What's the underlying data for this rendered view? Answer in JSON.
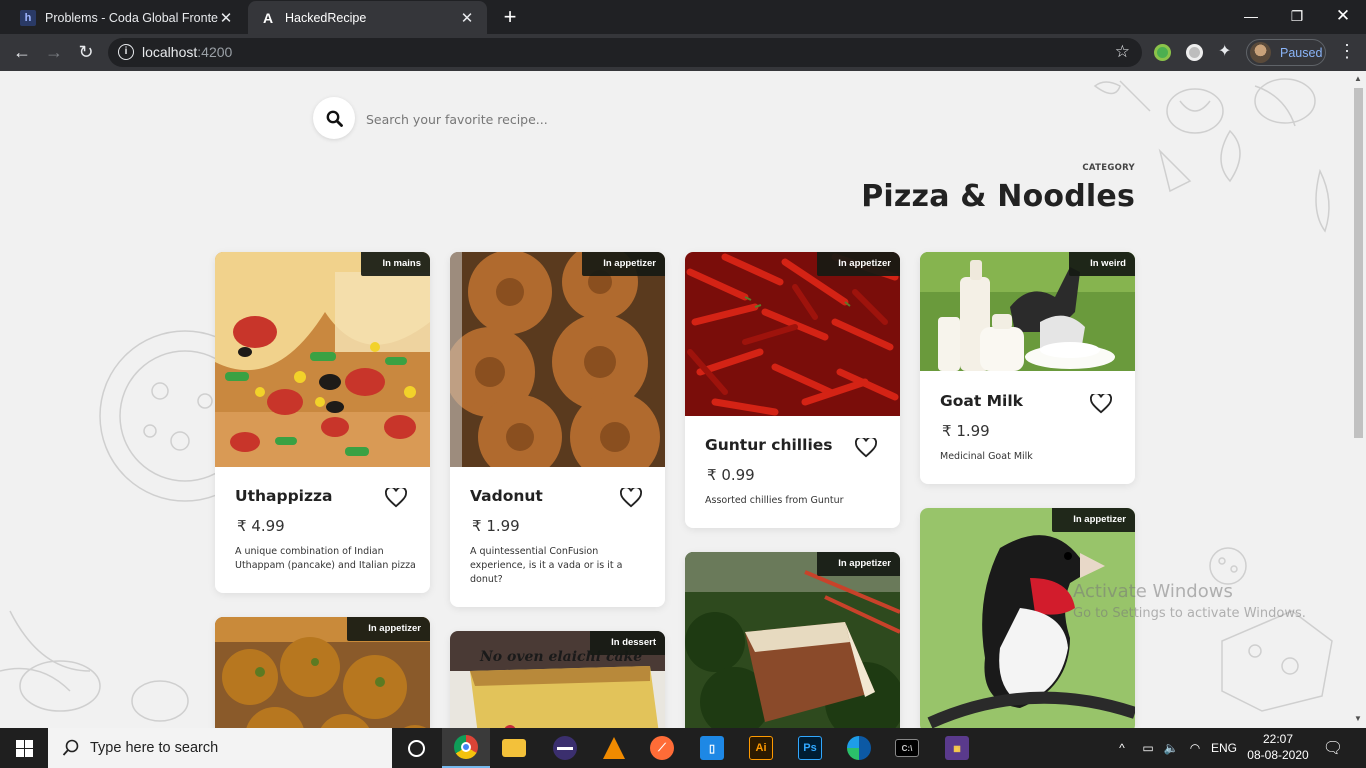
{
  "browser": {
    "tabs": [
      {
        "title": "Problems - Coda Global Frontend",
        "favicon": "h",
        "active": false
      },
      {
        "title": "HackedRecipe",
        "favicon": "A",
        "active": true
      }
    ],
    "url_host": "localhost",
    "url_port": ":4200",
    "profile_status": "Paused"
  },
  "search": {
    "placeholder": "Search your favorite recipe..."
  },
  "category": {
    "label": "CATEGORY",
    "title": "Pizza & Noodles"
  },
  "currency": "₹",
  "dishes": [
    {
      "name": "Uthappizza",
      "price": "4.99",
      "tag": "In mains",
      "description": "A unique combination of Indian Uthappam (pancake) and Italian pizza"
    },
    {
      "name": "Vadonut",
      "price": "1.99",
      "tag": "In appetizer",
      "description": "A quintessential ConFusion experience, is it a vada or is it a donut?"
    },
    {
      "name": "Guntur chillies",
      "price": "0.99",
      "tag": "In appetizer",
      "description": "Assorted chillies from Guntur"
    },
    {
      "name": "Goat Milk",
      "price": "1.99",
      "tag": "In weird",
      "description": "Medicinal Goat Milk"
    },
    {
      "tag": "In appetizer"
    },
    {
      "tag": "In dessert",
      "image_caption": "No oven elaichi cake"
    },
    {
      "tag": "In appetizer"
    },
    {
      "tag": "In appetizer"
    }
  ],
  "windows": {
    "watermark_title": "Activate Windows",
    "watermark_sub": "Go to Settings to activate Windows.",
    "search_placeholder": "Type here to search",
    "language": "ENG",
    "time": "22:07",
    "date": "08-08-2020"
  },
  "colors": {
    "page_bg": "#f1f1f1",
    "tag_bg": "#161a14",
    "chrome_dark": "#202124",
    "chrome_toolbar": "#35363a",
    "taskbar": "#1f1f1f"
  },
  "icons": [
    "search-icon",
    "heart-icon",
    "rupee-icon",
    "star-icon",
    "extensions-icon",
    "windows-logo-icon",
    "cortana-icon",
    "chrome-icon",
    "file-explorer-icon",
    "vlc-icon",
    "photoshop-icon",
    "illustrator-icon",
    "edge-icon"
  ]
}
